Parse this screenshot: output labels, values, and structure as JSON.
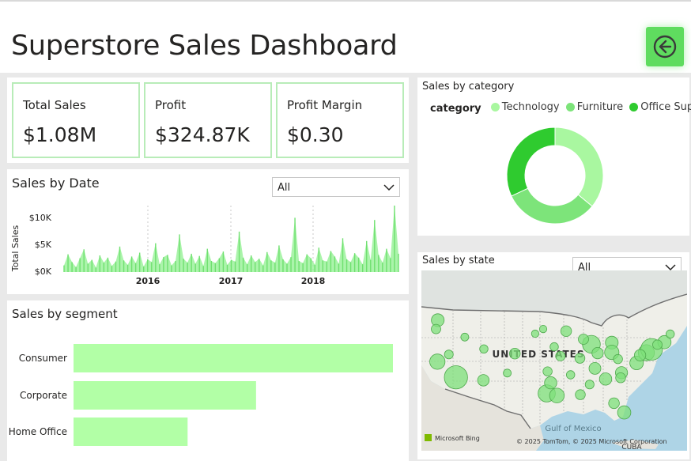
{
  "header": {
    "title": "Superstore Sales Dashboard",
    "back_icon": "arrow-left-circle-icon",
    "accent": "#5fdc5f"
  },
  "kpis": [
    {
      "label": "Total Sales",
      "value": "$1.08M"
    },
    {
      "label": "Profit",
      "value": "$324.87K"
    },
    {
      "label": "Profit Margin",
      "value": "$0.30"
    }
  ],
  "sales_by_date": {
    "title": "Sales by Date",
    "filter": {
      "selected": "All"
    }
  },
  "sales_by_segment": {
    "title": "Sales by segment"
  },
  "sales_by_category": {
    "title": "Sales by category",
    "legend_title": "category"
  },
  "sales_by_state": {
    "title": "Sales by state",
    "filter": {
      "selected": "All"
    },
    "map_label": "UNITED STATES",
    "gulf_label": "Gulf of Mexico",
    "cuba_label": "CUBA",
    "bing_label": "Microsoft Bing",
    "attribution": "© 2025 TomTom, © 2025 Microsoft Corporation"
  },
  "chart_data": [
    {
      "type": "line",
      "title": "Sales by Date",
      "xlabel": "",
      "ylabel": "Total Sales",
      "x_ticks": [
        "2016",
        "2017",
        "2018"
      ],
      "y_ticks": [
        "$0K",
        "$5K",
        "$10K"
      ],
      "ylim": [
        0,
        12000
      ],
      "color": "#8ff08f",
      "grid": false,
      "series": [
        {
          "values": [
            1200,
            3200,
            1800,
            900,
            2500,
            4100,
            1500,
            2200,
            800,
            3000,
            1700,
            2600,
            1100,
            1900,
            4600,
            2100,
            1300,
            2800,
            1600,
            3500,
            1000,
            2300,
            1800,
            5200,
            1400,
            2700,
            3100,
            1200,
            2000,
            6800,
            2400,
            1700,
            3300,
            1500,
            2900,
            1100,
            4200,
            2000,
            1600,
            2500,
            3700,
            1300,
            2200,
            1900,
            7300,
            2600,
            1400,
            3000,
            1800,
            2400,
            1200,
            3600,
            2100,
            1700,
            4800,
            2300,
            1500,
            2700,
            9800,
            2000,
            1600,
            3200,
            2500,
            1300,
            4400,
            2100,
            1900,
            3800,
            2800,
            1500,
            6100,
            2300,
            1800,
            3400,
            2600,
            1400,
            5600,
            2200,
            9400,
            3100,
            1700,
            4200,
            2500,
            12000,
            3300
          ]
        }
      ]
    },
    {
      "type": "bar",
      "title": "Sales by segment",
      "orientation": "horizontal",
      "categories": [
        "Consumer",
        "Corporate",
        "Home Office"
      ],
      "values": [
        560000,
        320000,
        200000
      ],
      "color": "#b2ffa6"
    },
    {
      "type": "pie",
      "title": "Sales by category",
      "donut": true,
      "legend_title": "category",
      "legend_position": "top",
      "categories": [
        "Technology",
        "Furniture",
        "Office Supplies"
      ],
      "values": [
        36,
        32,
        32
      ],
      "colors": [
        "#a9f7a0",
        "#7de47a",
        "#2fcb2f"
      ]
    }
  ],
  "map_points": [
    {
      "lon": -122.4,
      "lat": 37.8,
      "value": 33
    },
    {
      "lon": -118.2,
      "lat": 34.1,
      "value": 95
    },
    {
      "lon": -122.3,
      "lat": 47.6,
      "value": 20
    },
    {
      "lon": -122.7,
      "lat": 45.5,
      "value": 8
    },
    {
      "lon": -112.0,
      "lat": 33.4,
      "value": 15
    },
    {
      "lon": -104.9,
      "lat": 39.7,
      "value": 12
    },
    {
      "lon": -111.9,
      "lat": 40.8,
      "value": 5
    },
    {
      "lon": -116.2,
      "lat": 43.6,
      "value": 4
    },
    {
      "lon": -106.6,
      "lat": 35.1,
      "value": 4
    },
    {
      "lon": -119.8,
      "lat": 39.5,
      "value": 6
    },
    {
      "lon": -97.7,
      "lat": 30.3,
      "value": 45
    },
    {
      "lon": -96.8,
      "lat": 32.8,
      "value": 18
    },
    {
      "lon": -95.4,
      "lat": 29.8,
      "value": 30
    },
    {
      "lon": -97.5,
      "lat": 35.5,
      "value": 7
    },
    {
      "lon": -93.3,
      "lat": 45.0,
      "value": 12
    },
    {
      "lon": -87.6,
      "lat": 41.9,
      "value": 50
    },
    {
      "lon": -83.0,
      "lat": 42.3,
      "value": 20
    },
    {
      "lon": -83.0,
      "lat": 40.0,
      "value": 28
    },
    {
      "lon": -86.2,
      "lat": 39.8,
      "value": 14
    },
    {
      "lon": -90.2,
      "lat": 38.6,
      "value": 9
    },
    {
      "lon": -86.8,
      "lat": 36.2,
      "value": 16
    },
    {
      "lon": -84.4,
      "lat": 33.7,
      "value": 18
    },
    {
      "lon": -80.8,
      "lat": 35.2,
      "value": 17
    },
    {
      "lon": -77.4,
      "lat": 37.5,
      "value": 24
    },
    {
      "lon": -75.2,
      "lat": 39.9,
      "value": 38
    },
    {
      "lon": -74.0,
      "lat": 40.7,
      "value": 80
    },
    {
      "lon": -71.1,
      "lat": 42.4,
      "value": 22
    },
    {
      "lon": -72.7,
      "lat": 41.8,
      "value": 8
    },
    {
      "lon": -80.2,
      "lat": 25.8,
      "value": 22
    },
    {
      "lon": -82.5,
      "lat": 28.0,
      "value": 12
    },
    {
      "lon": -90.1,
      "lat": 30.0,
      "value": 9
    },
    {
      "lon": -92.3,
      "lat": 34.7,
      "value": 5
    },
    {
      "lon": -89.4,
      "lat": 43.1,
      "value": 10
    },
    {
      "lon": -94.6,
      "lat": 39.1,
      "value": 8
    },
    {
      "lon": -96.0,
      "lat": 41.3,
      "value": 5
    },
    {
      "lon": -100.3,
      "lat": 44.4,
      "value": 3
    },
    {
      "lon": -98.5,
      "lat": 45.5,
      "value": 3
    },
    {
      "lon": -69.8,
      "lat": 44.3,
      "value": 5
    },
    {
      "lon": -76.6,
      "lat": 39.3,
      "value": 14
    },
    {
      "lon": -81.6,
      "lat": 38.4,
      "value": 7
    },
    {
      "lon": -88.0,
      "lat": 32.4,
      "value": 6
    },
    {
      "lon": -81.0,
      "lat": 34.0,
      "value": 9
    }
  ]
}
